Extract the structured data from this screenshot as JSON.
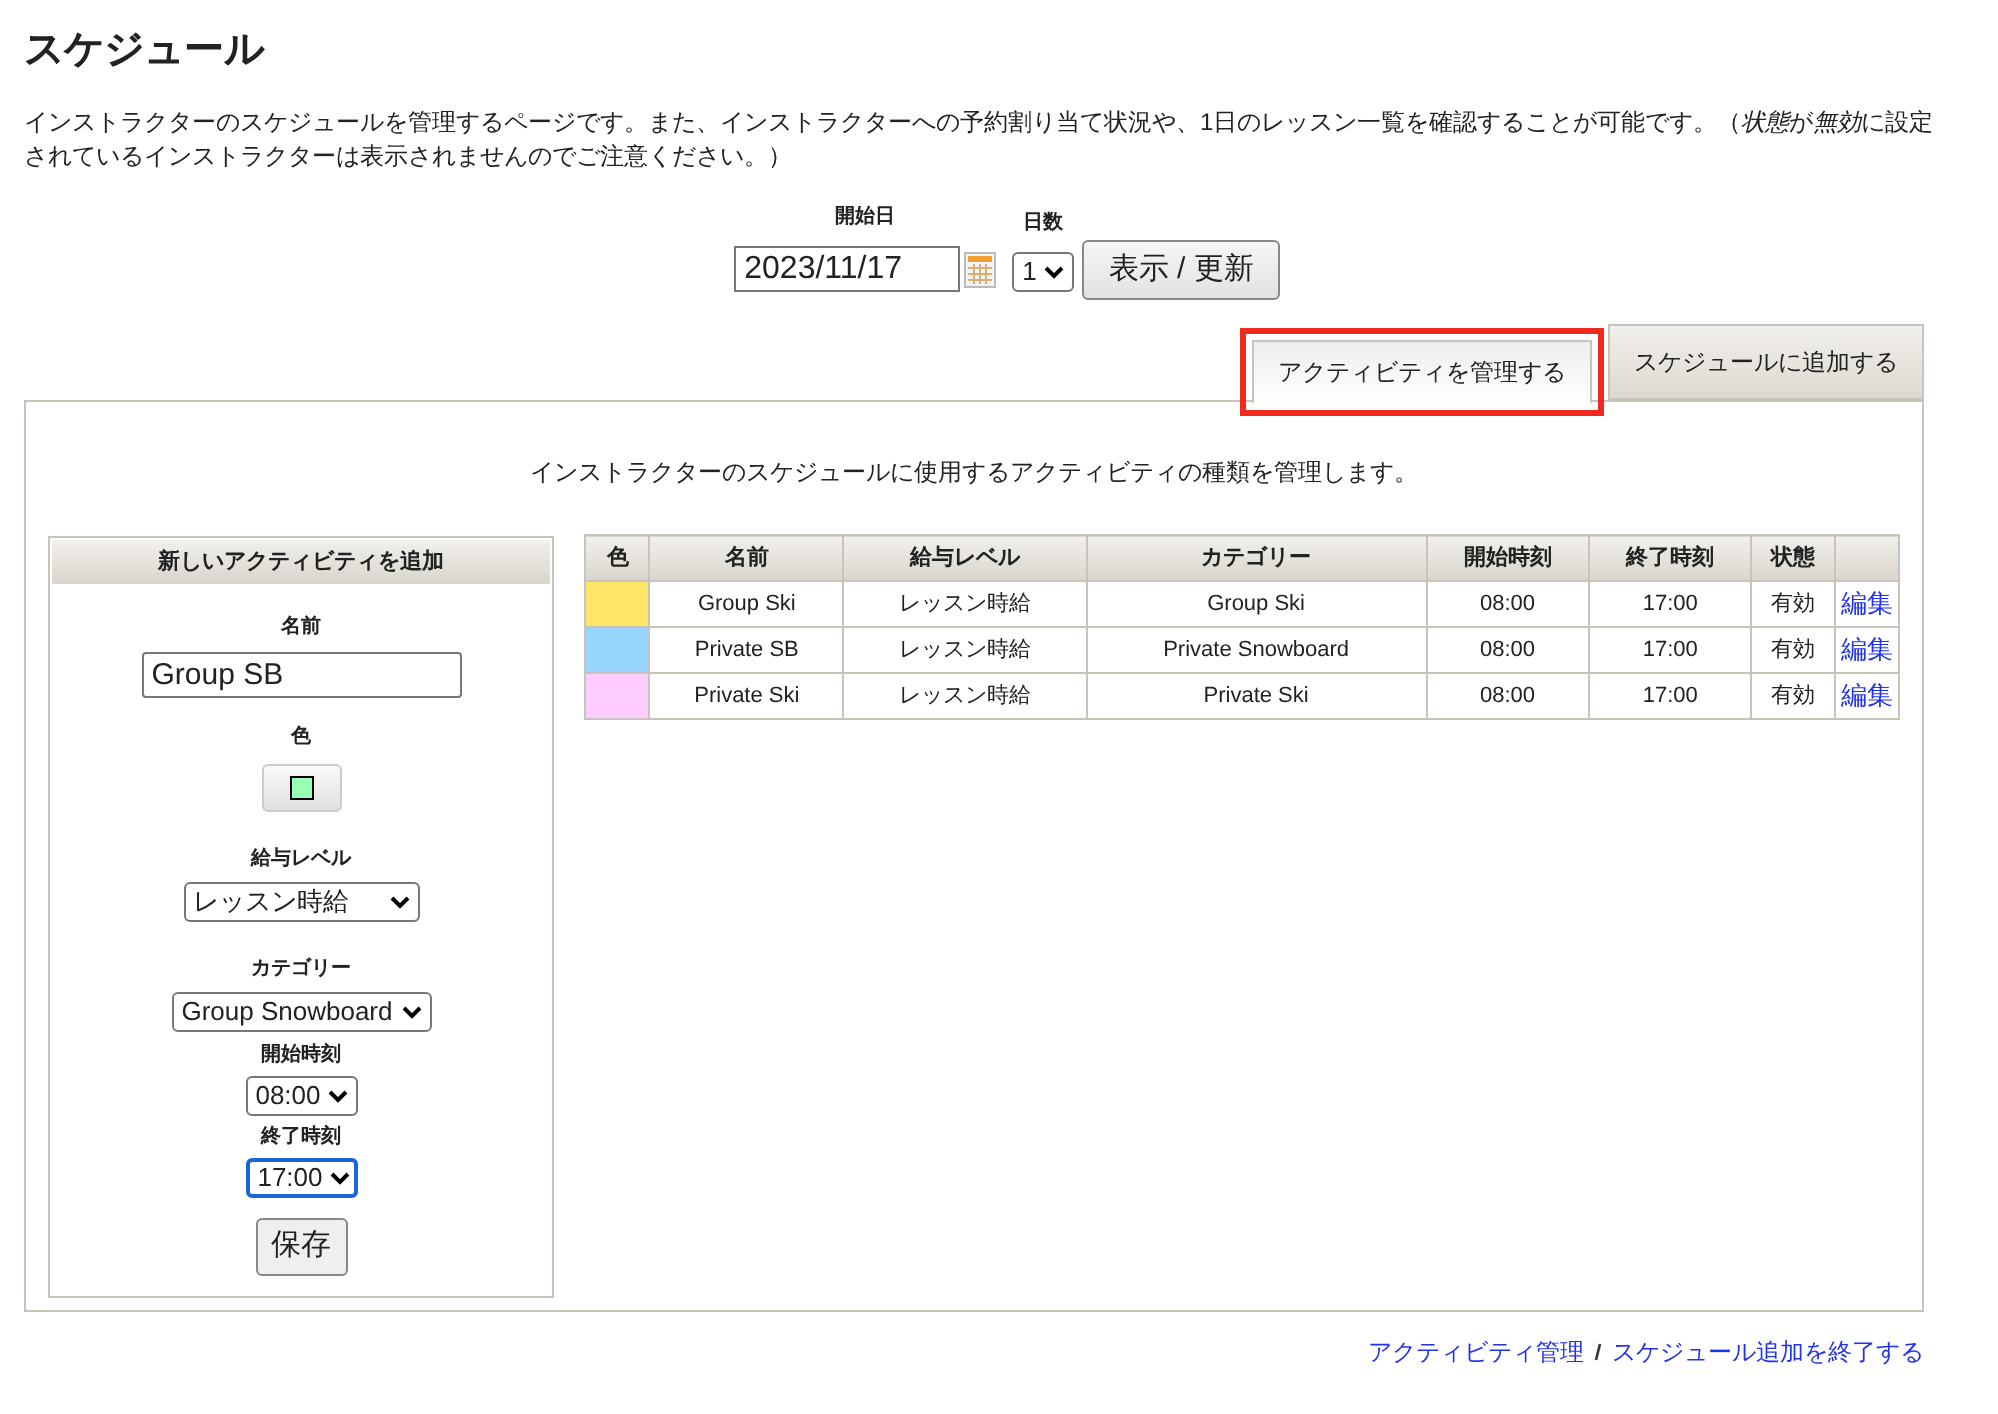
{
  "page_title": "スケジュール",
  "intro": [
    {
      "text": "インストラクターのスケジュールを管理するページです。また、インストラクターへの予約割り当て状況や、1日のレッスン一覧を確認することが可能です。（",
      "italic": false
    },
    {
      "text": "状態",
      "italic": true
    },
    {
      "text": "が",
      "italic": false
    },
    {
      "text": "無効",
      "italic": true
    },
    {
      "text": "に設定されているインストラクターは表示されませんのでご注意ください。）",
      "italic": false
    }
  ],
  "date_form": {
    "start_label": "開始日",
    "start_value": "2023/11/17",
    "days_label": "日数",
    "days_value": "1",
    "submit": "表示 / 更新"
  },
  "tabs": [
    {
      "label": "アクティビティを管理する",
      "selected": true,
      "highlighted": true
    },
    {
      "label": "スケジュールに追加する",
      "selected": false,
      "highlighted": false
    }
  ],
  "panel_description": "インストラクターのスケジュールに使用するアクティビティの種類を管理します。",
  "new_activity": {
    "title": "新しいアクティビティを追加",
    "name_label": "名前",
    "name_value": "Group SB",
    "color_label": "色",
    "color": "#99ffb3",
    "pay_label": "給与レベル",
    "pay_value": "レッスン時給",
    "category_label": "カテゴリー",
    "category_value": "Group Snowboard",
    "start_label": "開始時刻",
    "start_value": "08:00",
    "end_label": "終了時刻",
    "end_value": "17:00",
    "save": "保存"
  },
  "table": {
    "columns": [
      "色",
      "名前",
      "給与レベル",
      "カテゴリー",
      "開始時刻",
      "終了時刻",
      "状態"
    ],
    "rows": [
      {
        "color": "#ffe566",
        "name": "Group Ski",
        "pay": "レッスン時給",
        "category": "Group Ski",
        "start": "08:00",
        "end": "17:00",
        "status": "有効",
        "action": "編集"
      },
      {
        "color": "#99d6ff",
        "name": "Private SB",
        "pay": "レッスン時給",
        "category": "Private Snowboard",
        "start": "08:00",
        "end": "17:00",
        "status": "有効",
        "action": "編集"
      },
      {
        "color": "#ffccff",
        "name": "Private Ski",
        "pay": "レッスン時給",
        "category": "Private Ski",
        "start": "08:00",
        "end": "17:00",
        "status": "有効",
        "action": "編集"
      }
    ]
  },
  "footer_links": [
    "アクティビティ管理",
    "スケジュール追加を終了する"
  ]
}
